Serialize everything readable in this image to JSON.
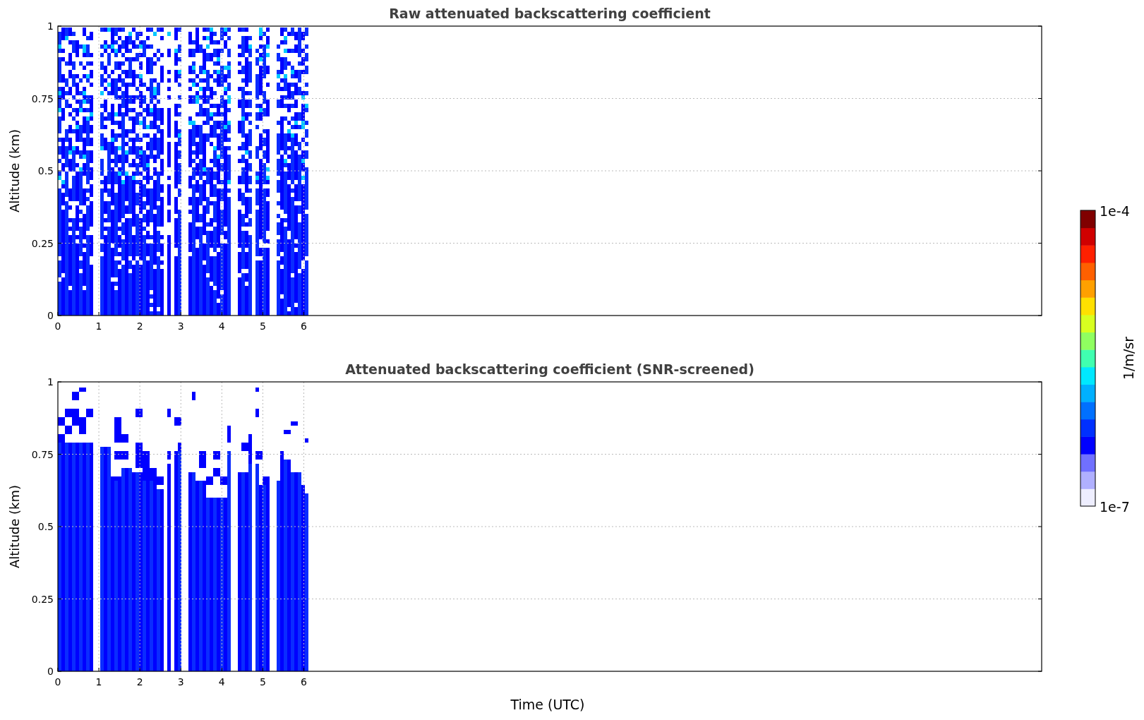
{
  "figure": {
    "panels": [
      {
        "title": "Raw attenuated backscattering coefficient",
        "ylabel": "Altitude (km)",
        "yticks": [
          "1",
          "0.75",
          "0.5",
          "0.25",
          "0"
        ],
        "xticks": [
          "0",
          "1",
          "2",
          "3",
          "4",
          "5",
          "6"
        ],
        "kind": "raw"
      },
      {
        "title": "Attenuated backscattering coefficient (SNR-screened)",
        "ylabel": "Altitude (km)",
        "yticks": [
          "1",
          "0.75",
          "0.5",
          "0.25",
          "0"
        ],
        "xticks": [
          "0",
          "1",
          "2",
          "3",
          "4",
          "5",
          "6"
        ],
        "kind": "screened"
      }
    ],
    "xlabel": "Time (UTC)",
    "colorbar": {
      "label": "1/m/sr",
      "max": "1e-4",
      "min": "1e-7"
    }
  }
}
